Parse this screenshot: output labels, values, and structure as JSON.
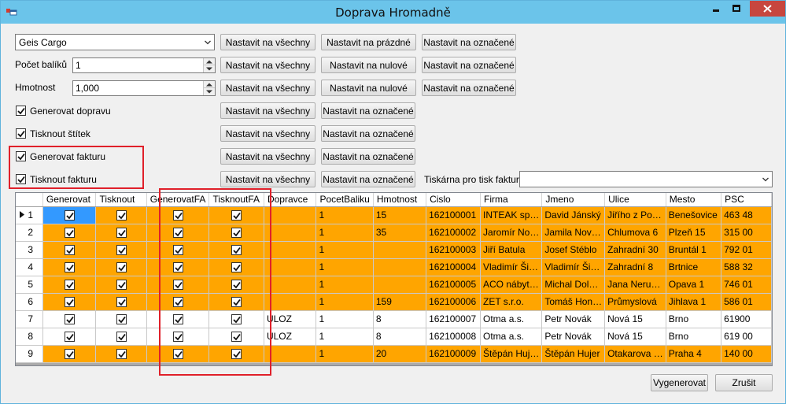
{
  "window": {
    "title": "Doprava Hromadně"
  },
  "colors": {
    "row_orange": "#ffa500",
    "row_white": "#ffffff",
    "selection": "#3399ff",
    "highlight_box": "#e0202a",
    "titlebar": "#6bc4ea",
    "close_red": "#c7463e"
  },
  "carrier": {
    "selected": "Geis Cargo"
  },
  "package_count": {
    "label": "Počet balíků",
    "value": "1"
  },
  "weight": {
    "label": "Hmotnost",
    "value": "1,000"
  },
  "options": {
    "generate_transport": {
      "label": "Generovat dopravu",
      "checked": true
    },
    "print_label": {
      "label": "Tisknout štítek",
      "checked": true
    },
    "generate_invoice": {
      "label": "Generovat fakturu",
      "checked": true
    },
    "print_invoice": {
      "label": "Tisknout fakturu",
      "checked": true
    }
  },
  "buttons": {
    "set_all": "Nastavit na všechny",
    "set_empty": "Nastavit na prázdné",
    "set_marked": "Nastavit na označené",
    "set_zero": "Nastavit na nulové",
    "generate": "Vygenerovat",
    "cancel": "Zrušit"
  },
  "invoice_printer": {
    "label": "Tiskárna pro tisk faktury",
    "value": ""
  },
  "grid": {
    "columns": [
      "Generovat",
      "Tisknout",
      "GenerovatFA",
      "TisknoutFA",
      "Dopravce",
      "PocetBaliku",
      "Hmotnost",
      "Cislo",
      "Firma",
      "Jmeno",
      "Ulice",
      "Mesto",
      "PSC"
    ],
    "rows": [
      {
        "num": "1",
        "color": "orange",
        "current": true,
        "dopravce": "",
        "pocet": "1",
        "hmotnost": "15",
        "cislo": "162100001",
        "firma": "INTEAK sp…",
        "jmeno": "David Jánský",
        "ulice": "Jiřího z Po…",
        "mesto": "Benešovice",
        "psc": "463 48"
      },
      {
        "num": "2",
        "color": "orange",
        "dopravce": "",
        "pocet": "1",
        "hmotnost": "35",
        "cislo": "162100002",
        "firma": "Jaromír No…",
        "jmeno": "Jamila Nov…",
        "ulice": "Chlumova 6",
        "mesto": "Plzeň 15",
        "psc": "315 00"
      },
      {
        "num": "3",
        "color": "orange",
        "dopravce": "",
        "pocet": "1",
        "hmotnost": "",
        "cislo": "162100003",
        "firma": "Jiří Batula",
        "jmeno": "Josef Stéblo",
        "ulice": "Zahradní 30",
        "mesto": "Bruntál 1",
        "psc": "792 01"
      },
      {
        "num": "4",
        "color": "orange",
        "dopravce": "",
        "pocet": "1",
        "hmotnost": "",
        "cislo": "162100004",
        "firma": "Vladimír Ši…",
        "jmeno": "Vladimír Ši…",
        "ulice": "Zahradní 8",
        "mesto": "Brtnice",
        "psc": "588 32"
      },
      {
        "num": "5",
        "color": "orange",
        "dopravce": "",
        "pocet": "1",
        "hmotnost": "",
        "cislo": "162100005",
        "firma": "ACO nábyt…",
        "jmeno": "Michal Dol…",
        "ulice": "Jana Neru…",
        "mesto": "Opava 1",
        "psc": "746 01"
      },
      {
        "num": "6",
        "color": "orange",
        "dopravce": "",
        "pocet": "1",
        "hmotnost": "159",
        "cislo": "162100006",
        "firma": "ZET s.r.o.",
        "jmeno": "Tomáš Hon…",
        "ulice": "Průmyslová",
        "mesto": "Jihlava 1",
        "psc": "586 01"
      },
      {
        "num": "7",
        "color": "white",
        "dopravce": "ULOZ",
        "pocet": "1",
        "hmotnost": "8",
        "cislo": "162100007",
        "firma": "Otma a.s.",
        "jmeno": "Petr Novák",
        "ulice": "Nová 15",
        "mesto": "Brno",
        "psc": "61900"
      },
      {
        "num": "8",
        "color": "white",
        "dopravce": "ULOZ",
        "pocet": "1",
        "hmotnost": "8",
        "cislo": "162100008",
        "firma": "Otma a.s.",
        "jmeno": "Petr Novák",
        "ulice": "Nová 15",
        "mesto": "Brno",
        "psc": "619 00"
      },
      {
        "num": "9",
        "color": "orange",
        "dopravce": "",
        "pocet": "1",
        "hmotnost": "20",
        "cislo": "162100009",
        "firma": "Štěpán Huj…",
        "jmeno": "Štěpán Hujer",
        "ulice": "Otakarova …",
        "mesto": "Praha 4",
        "psc": "140 00"
      }
    ]
  }
}
